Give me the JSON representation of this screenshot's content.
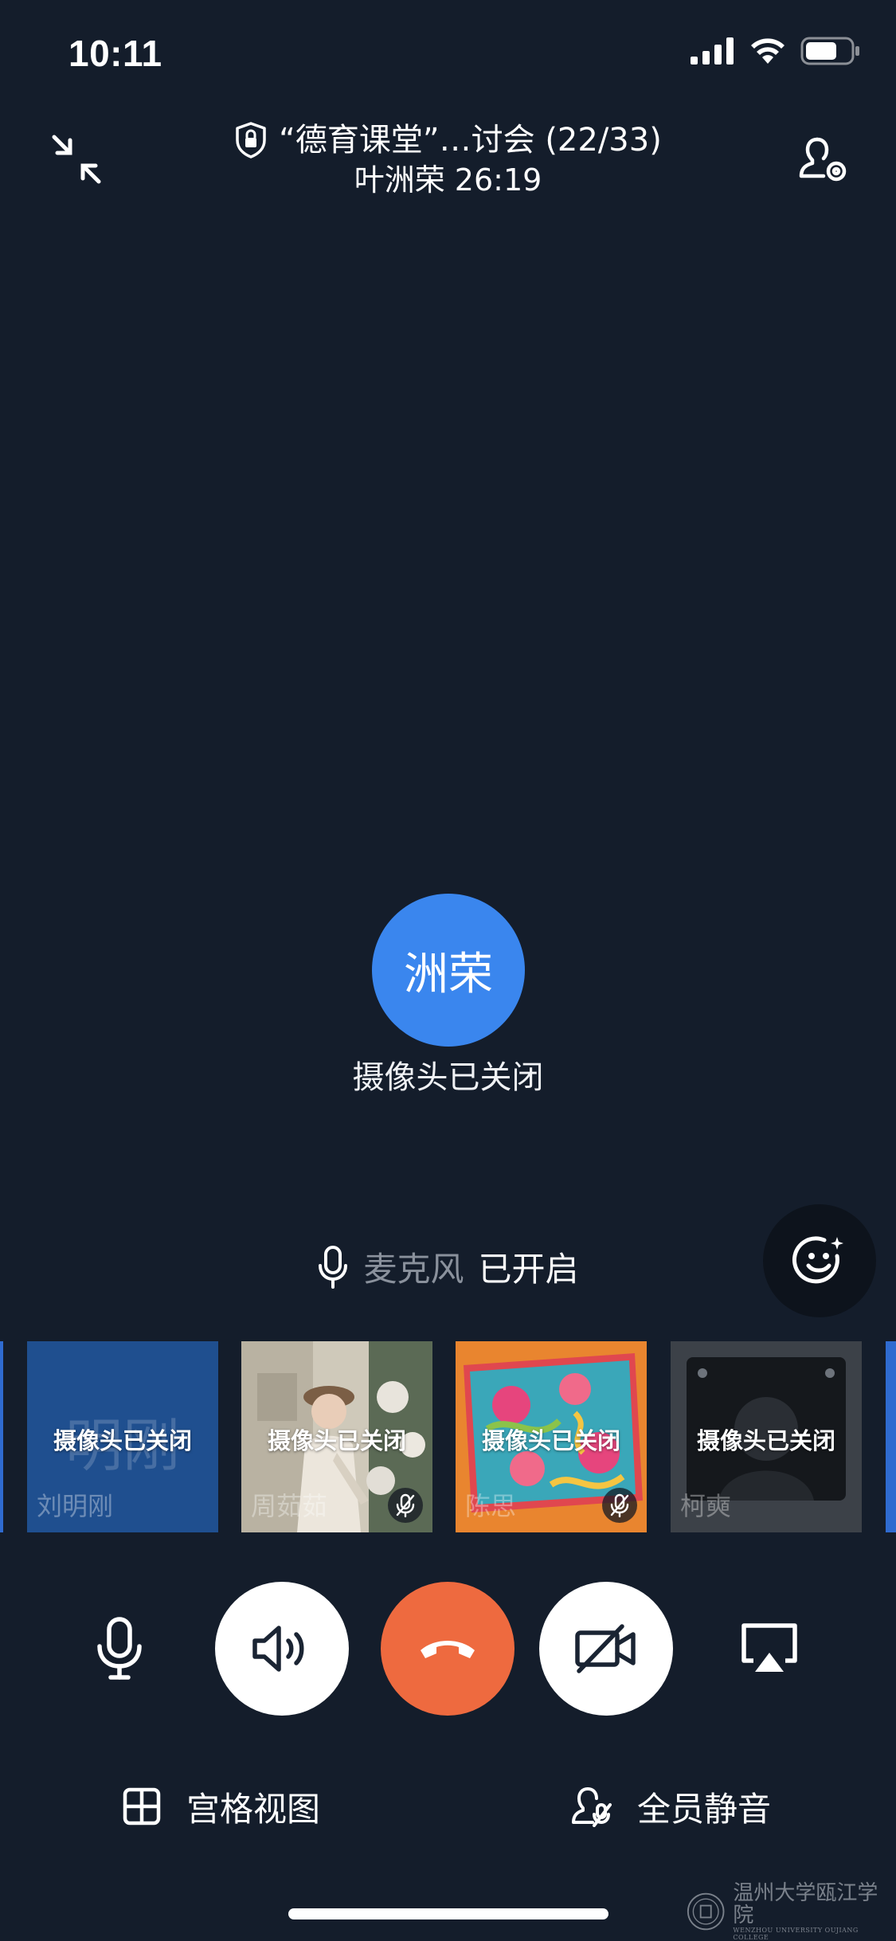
{
  "status_bar": {
    "time": "10:11"
  },
  "header": {
    "title": "“德育课堂”…讨会 (22/33)",
    "subtitle": "叶洲荣 26:19"
  },
  "speaker": {
    "avatar_text": "洲荣",
    "camera_status": "摄像头已关闭",
    "avatar_color": "#3a86ee"
  },
  "mic_status": {
    "name": "麦克风",
    "state": "已开启"
  },
  "participants": [
    {
      "name": "刘明刚",
      "initials": "明刚",
      "status": "摄像头已关闭",
      "muted": false,
      "bg": "#1f4f8f"
    },
    {
      "name": "周茹茹",
      "status": "摄像头已关闭",
      "muted": true,
      "bg": "#c9c3b5"
    },
    {
      "name": "陈思",
      "status": "摄像头已关闭",
      "muted": true,
      "bg": "#e47a2c"
    },
    {
      "name": "柯奭",
      "status": "摄像头已关闭",
      "muted": false,
      "bg": "#2a2e35"
    }
  ],
  "controls": {
    "end_call_color": "#ee6a3f"
  },
  "bottom": {
    "grid_view": "宫格视图",
    "mute_all": "全员静音"
  },
  "watermark": {
    "text": "温州大学瓯江学院",
    "sub": "WENZHOU UNIVERSITY OUJIANG COLLEGE"
  }
}
